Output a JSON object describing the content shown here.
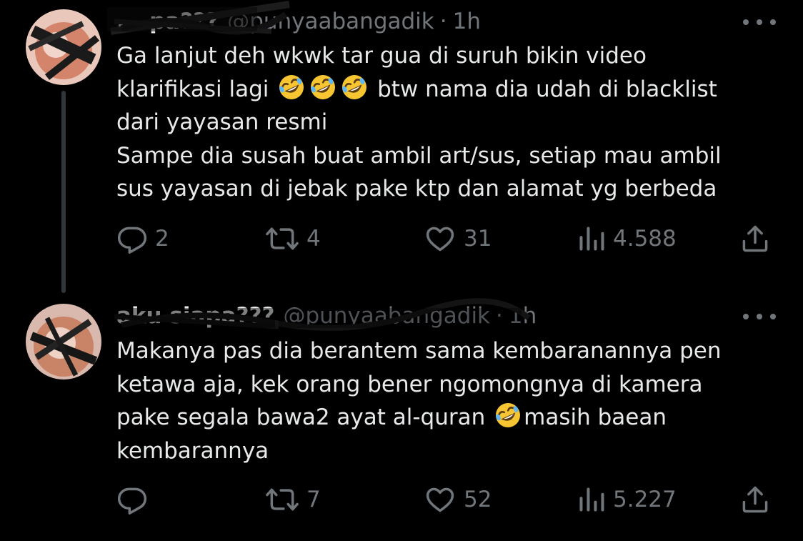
{
  "tweets": [
    {
      "display_name": "... pa???",
      "handle": "@punyaabangadik",
      "separator": "·",
      "time": "1h",
      "lines": [
        "Ga lanjut deh wkwk tar gua di suruh bikin video",
        "klarifikasi lagi",
        "btw nama dia udah di blacklist",
        "dari yayasan resmi",
        "Sampe dia susah buat ambil art/sus, setiap mau ambil",
        "sus yayasan di jebak pake ktp dan alamat yg berbeda"
      ],
      "replies": "2",
      "reposts": "4",
      "likes": "31",
      "views": "4.588"
    },
    {
      "display_name": "aku siapa???",
      "handle": "@punyaabangadik",
      "separator": "·",
      "time": "1h",
      "lines": [
        "Makanya pas dia berantem sama kembaranannya pen",
        "ketawa aja, kek orang bener ngomongnya di kamera",
        "pake segala bawa2 ayat al-quran",
        "masih baean",
        "kembarannya"
      ],
      "replies": "",
      "reposts": "7",
      "likes": "52",
      "views": "5.227"
    }
  ],
  "icons": {
    "reply": "reply-icon",
    "repost": "repost-icon",
    "like": "like-icon",
    "views": "views-icon",
    "share": "share-icon",
    "more": "more-icon",
    "emoji": "rolling-on-floor-laughing-emoji"
  },
  "colors": {
    "background": "#000000",
    "text": "#e7e9ea",
    "muted": "#71767b",
    "thread_line": "#333639"
  }
}
